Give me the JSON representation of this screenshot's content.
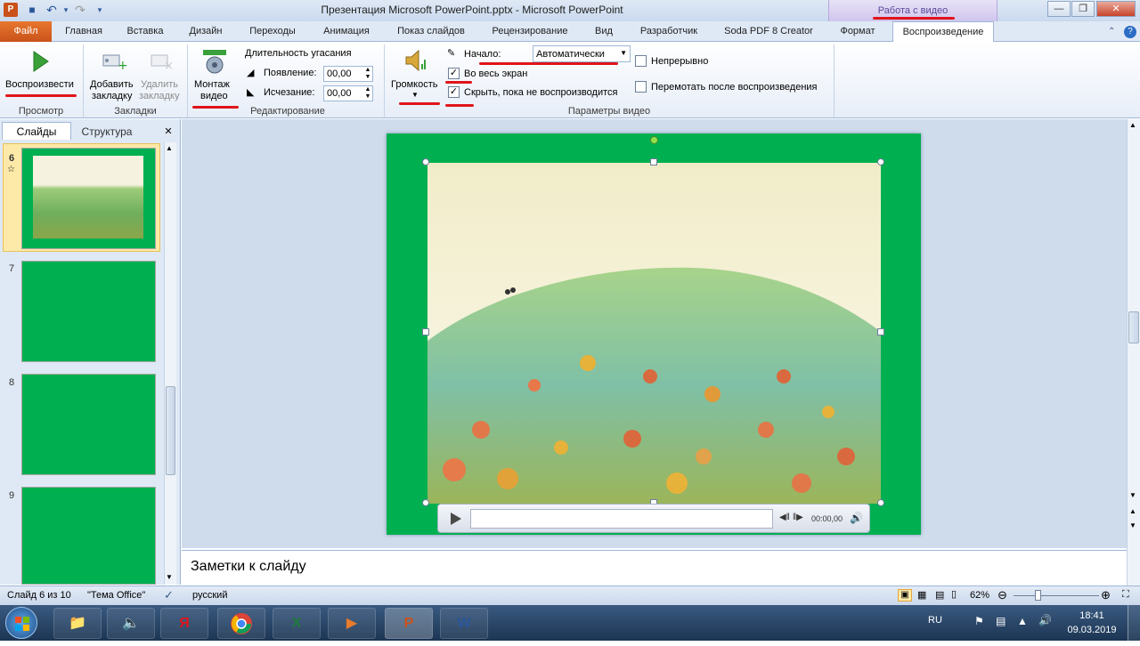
{
  "window": {
    "title": "Презентация Microsoft PowerPoint.pptx  -  Microsoft PowerPoint",
    "context_group": "Работа с видео",
    "min_icon": "minimize-icon",
    "max_icon": "maximize-icon",
    "close_icon": "close-icon"
  },
  "qat": {
    "save": "■",
    "undo": "↶",
    "redo": "↷",
    "more": "▾"
  },
  "tabs": {
    "file": "Файл",
    "items": [
      "Главная",
      "Вставка",
      "Дизайн",
      "Переходы",
      "Анимация",
      "Показ слайдов",
      "Рецензирование",
      "Вид",
      "Разработчик",
      "Soda PDF 8 Creator",
      "Формат",
      "Воспроизведение"
    ],
    "help": "?"
  },
  "ribbon": {
    "preview": {
      "play": "Воспроизвести",
      "group": "Просмотр"
    },
    "bookmarks": {
      "add_line1": "Добавить",
      "add_line2": "закладку",
      "remove_line1": "Удалить",
      "remove_line2": "закладку",
      "group": "Закладки"
    },
    "editing": {
      "trim_line1": "Монтаж",
      "trim_line2": "видео",
      "fade_title": "Длительность угасания",
      "fade_in_label": "Появление:",
      "fade_in_value": "00,00",
      "fade_out_label": "Исчезание:",
      "fade_out_value": "00,00",
      "group": "Редактирование"
    },
    "options": {
      "volume": "Громкость",
      "start_label": "Начало:",
      "start_value": "Автоматически",
      "fullscreen": "Во весь экран",
      "hide": "Скрыть, пока не воспроизводится",
      "loop": "Непрерывно",
      "rewind": "Перемотать после воспроизведения",
      "group": "Параметры видео"
    }
  },
  "left_pane": {
    "tab_slides": "Слайды",
    "tab_outline": "Структура",
    "close": "✕",
    "slides": [
      "6",
      "7",
      "8",
      "9"
    ]
  },
  "video": {
    "time": "00:00,00"
  },
  "notes": {
    "placeholder": "Заметки к слайду"
  },
  "status": {
    "slide": "Слайд 6 из 10",
    "theme": "\"Тема Office\"",
    "lang": "русский",
    "zoom": "62%"
  },
  "taskbar": {
    "lang": "RU",
    "time": "18:41",
    "date": "09.03.2019",
    "apps": [
      "Я"
    ]
  },
  "colors": {
    "slide": "#00b050",
    "accent": "#e0141a",
    "file_tab": "#d35f1e"
  }
}
